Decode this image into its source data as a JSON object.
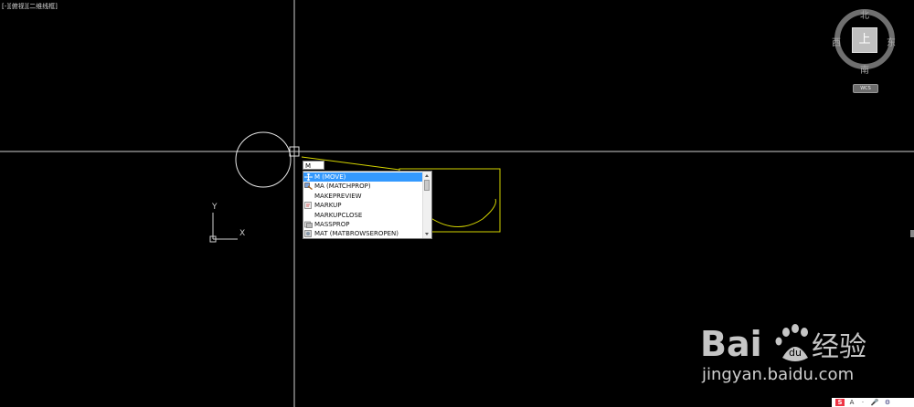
{
  "viewport": {
    "label": "[-][俯视][二维线框]"
  },
  "command": {
    "input_value": "M",
    "suggestions": [
      {
        "label": "M (MOVE)",
        "icon": "move-icon",
        "selected": true
      },
      {
        "label": "MA (MATCHPROP)",
        "icon": "matchprop-icon",
        "selected": false
      },
      {
        "label": "MAKEPREVIEW",
        "icon": "",
        "selected": false
      },
      {
        "label": "MARKUP",
        "icon": "markup-icon",
        "selected": false
      },
      {
        "label": "MARKUPCLOSE",
        "icon": "",
        "selected": false
      },
      {
        "label": "MASSPROP",
        "icon": "massprop-icon",
        "selected": false
      },
      {
        "label": "MAT (MATBROWSEROPEN)",
        "icon": "material-browser-icon",
        "selected": false
      }
    ]
  },
  "viewcube": {
    "north": "北",
    "south": "南",
    "east": "东",
    "west": "西",
    "face": "上",
    "wcs": "WCS"
  },
  "ucs": {
    "x_label": "X",
    "y_label": "Y"
  },
  "watermark": {
    "brand": "Bai经验",
    "url": "jingyan.baidu.com"
  },
  "tray": {
    "input_method": "S",
    "lang": "A",
    "items": [
      "·",
      "🎤",
      "⚙"
    ]
  },
  "colors": {
    "background": "#000000",
    "crosshair": "#ffffff",
    "selection": "#e6e600",
    "highlight": "#3399ff"
  }
}
